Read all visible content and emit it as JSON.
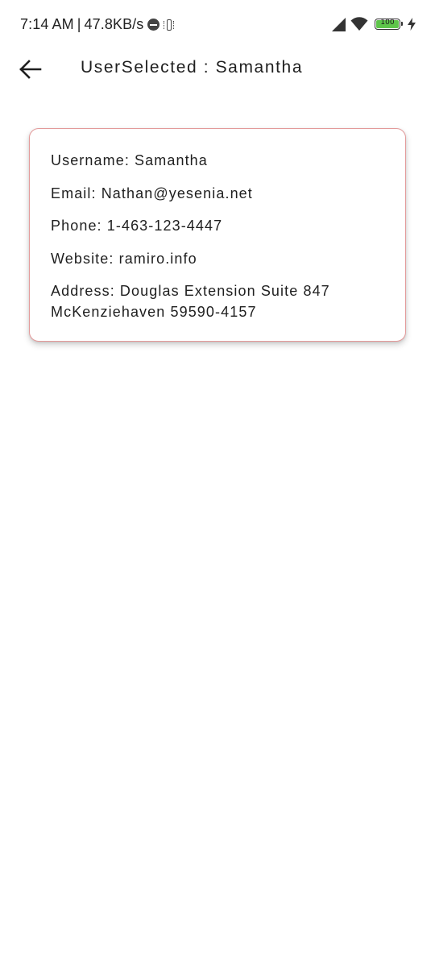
{
  "status_bar": {
    "time": "7:14 AM",
    "separator": "|",
    "network_speed": "47.8KB/s",
    "battery_level": "100",
    "battery_fraction": 1.0,
    "icons": [
      "do-not-disturb-icon",
      "vibrate-icon",
      "signal-icon",
      "wifi-icon",
      "battery-icon",
      "charging-icon"
    ],
    "battery_color": "#5ec54a"
  },
  "app_bar": {
    "back_icon": "arrow-left-icon",
    "title": "UserSelected : Samantha"
  },
  "user_card": {
    "border_color": "#e39a9a",
    "username": "Username: Samantha",
    "email": "Email: Nathan@yesenia.net",
    "phone": "Phone: 1-463-123-4447",
    "website": "Website: ramiro.info",
    "address_line1": "Address: Douglas Extension Suite 847",
    "address_line2": "McKenziehaven 59590-4157"
  }
}
